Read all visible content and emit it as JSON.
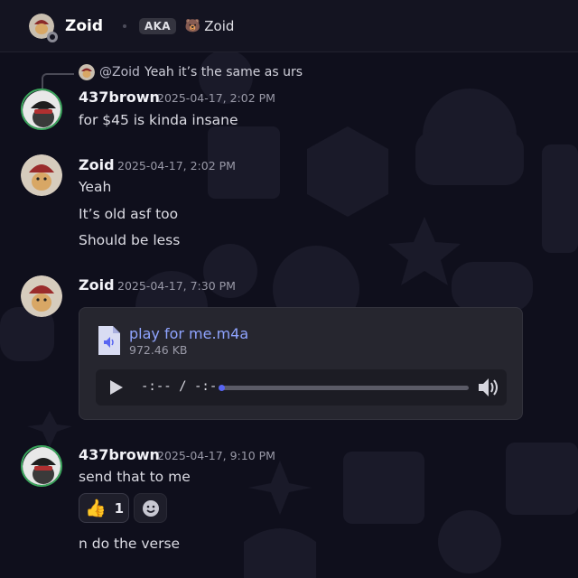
{
  "header": {
    "username": "Zoid",
    "aka_label": "AKA",
    "aka_emoji": "🐻",
    "aka_name": "Zoid"
  },
  "reply": {
    "mention": "@Zoid",
    "text": "Yeah it’s the same as urs"
  },
  "messages": [
    {
      "username": "437brown",
      "timestamp": "2025-04-17, 2:02 PM",
      "lines": [
        "for $45 is kinda insane"
      ]
    },
    {
      "username": "Zoid",
      "timestamp": "2025-04-17, 2:02 PM",
      "lines": [
        "Yeah",
        "It’s old asf too",
        "Should be less"
      ]
    },
    {
      "username": "Zoid",
      "timestamp": "2025-04-17, 7:30 PM",
      "lines": []
    },
    {
      "username": "437brown",
      "timestamp": "2025-04-17, 9:10 PM",
      "lines": [
        "send that to me",
        "n do the verse"
      ]
    }
  ],
  "attachment": {
    "file_name": "play for me.m4a",
    "file_size": "972.46 KB",
    "time_display": "-:-- / -:--",
    "progress": 0,
    "icon": "audio-file-icon"
  },
  "reaction": {
    "emoji": "👍",
    "count": "1"
  },
  "icons": {
    "play": "play-icon",
    "volume": "volume-icon",
    "add_reaction": "smiley-icon"
  },
  "colors": {
    "background": "#0f0f1c",
    "accent": "#5865f2",
    "link": "#8fa4ff",
    "online": "#3ba55c"
  }
}
